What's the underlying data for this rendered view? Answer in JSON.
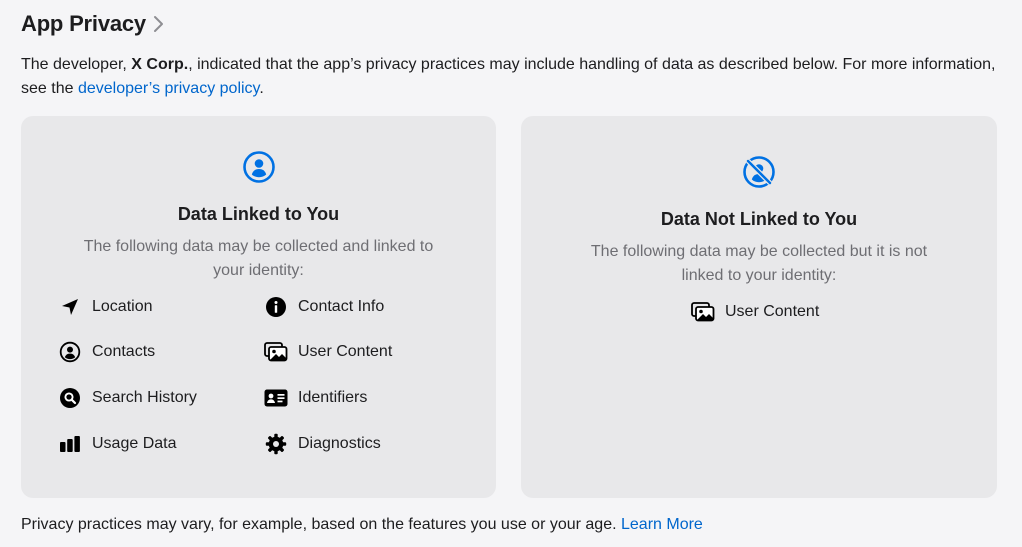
{
  "header": {
    "title": "App Privacy"
  },
  "intro": {
    "prefix": "The developer, ",
    "developer": "X Corp.",
    "middle": ", indicated that the app’s privacy practices may include handling of data as described below. For more information, see the ",
    "link": "developer’s privacy policy",
    "suffix": "."
  },
  "linked": {
    "title": "Data Linked to You",
    "description_line1": "The following data may be collected and linked to",
    "description_line2": "your identity:",
    "items": [
      {
        "label": "Location",
        "icon": "location-arrow-icon"
      },
      {
        "label": "Contact Info",
        "icon": "info-circle-icon"
      },
      {
        "label": "Contacts",
        "icon": "person-circle-icon"
      },
      {
        "label": "User Content",
        "icon": "photos-icon"
      },
      {
        "label": "Search History",
        "icon": "magnifier-circle-icon"
      },
      {
        "label": "Identifiers",
        "icon": "id-card-icon"
      },
      {
        "label": "Usage Data",
        "icon": "bar-chart-icon"
      },
      {
        "label": "Diagnostics",
        "icon": "gear-icon"
      }
    ]
  },
  "not_linked": {
    "title": "Data Not Linked to You",
    "description_line1": "The following data may be collected but it is not",
    "description_line2": "linked to your identity:",
    "items": [
      {
        "label": "User Content",
        "icon": "photos-icon"
      }
    ]
  },
  "footer": {
    "text": "Privacy practices may vary, for example, based on the features you use or your age.",
    "link": "Learn More"
  },
  "colors": {
    "accent": "#0071e3",
    "link": "#0066cc",
    "card": "#e8e8ea",
    "page": "#f5f5f7"
  }
}
